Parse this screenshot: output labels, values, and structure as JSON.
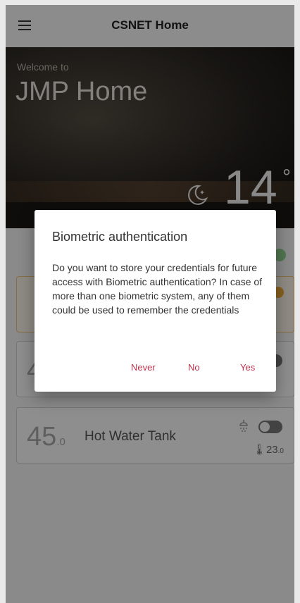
{
  "appbar": {
    "title": "CSNET Home"
  },
  "hero": {
    "welcome": "Welcome to",
    "home_name": "JMP Home",
    "temperature": "14",
    "degree": "°"
  },
  "cards": {
    "grey": {
      "value": "4"
    },
    "water": {
      "value": "45",
      "decimal": ".0",
      "label": "Hot Water Tank",
      "sub_value": "23",
      "sub_decimal": ".0"
    }
  },
  "dialog": {
    "title": "Biometric authentication",
    "body": "Do you want to store your credentials for future access with Biometric authentication? In case of more than one biometric system, any of them could be used to remember the credentials",
    "buttons": {
      "never": "Never",
      "no": "No",
      "yes": "Yes"
    }
  },
  "colors": {
    "accent": "#c0314d",
    "status_green": "#8fd08f",
    "status_orange": "#f0a934"
  }
}
